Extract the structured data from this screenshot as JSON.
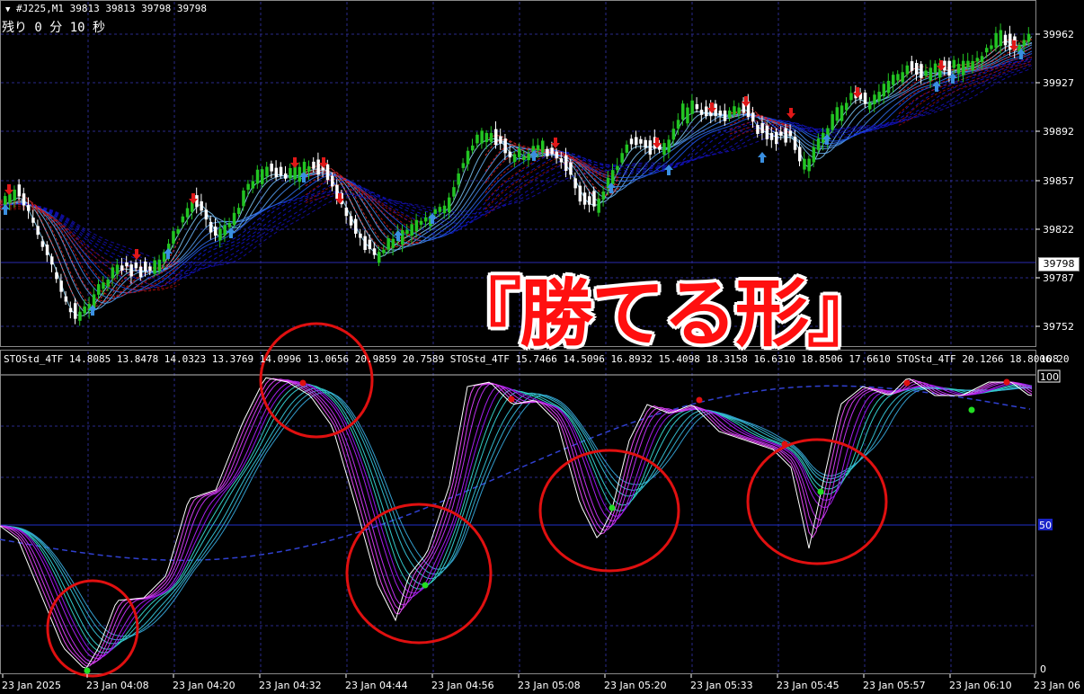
{
  "window": {
    "symbol_line": "#J225,M1  39813 39813 39798 39798",
    "countdown": "残り 0 分 10 秒"
  },
  "overlay_title": "『勝てる形』",
  "price_axis": {
    "labels": [
      "39962",
      "39927",
      "39892",
      "39857",
      "39822",
      "39787",
      "39752"
    ],
    "current_price": "39798"
  },
  "indicator": {
    "label": "STOStd_4TF 14.8085 13.8478 14.0323 13.3769 14.0996 13.0656 20.9859 20.7589  STOStd_4TF 15.7466 14.5096 16.8932 15.4098 18.3158 16.6310 18.8506 17.6610  STOStd_4TF 20.1266 18.8006 20",
    "axis_top": "108",
    "level_high": "100",
    "level_mid": "50",
    "level_low": "0"
  },
  "time_axis": {
    "labels": [
      "23 Jan 2025",
      "23 Jan 04:08",
      "23 Jan 04:20",
      "23 Jan 04:32",
      "23 Jan 04:44",
      "23 Jan 04:56",
      "23 Jan 05:08",
      "23 Jan 05:20",
      "23 Jan 05:33",
      "23 Jan 05:45",
      "23 Jan 05:57",
      "23 Jan 06:10",
      "23 Jan 06"
    ]
  },
  "colors": {
    "grid": "#2a2a8a",
    "bull": "#22c422",
    "bear": "#ffffff",
    "up_arrow": "#3a8fe0",
    "down_arrow": "#e01818",
    "highlight_circle": "#e01010",
    "mid_line": "#2030c8"
  }
}
